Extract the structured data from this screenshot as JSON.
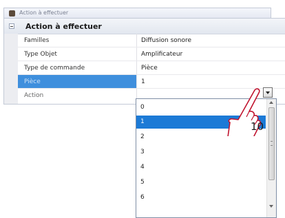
{
  "window": {
    "title": "Action à effectuer"
  },
  "category": {
    "label": "Action à effectuer"
  },
  "properties": [
    {
      "name": "Familles",
      "value": "Diffusion sonore"
    },
    {
      "name": "Type Objet",
      "value": "Amplificateur"
    },
    {
      "name": "Type de commande",
      "value": "Pièce"
    },
    {
      "name": "Pièce",
      "value": "1"
    },
    {
      "name": "Action",
      "value": ""
    }
  ],
  "dropdown": {
    "selected": "1",
    "options": [
      "0",
      "1",
      "2",
      "3",
      "4",
      "5",
      "6"
    ]
  },
  "callout": {
    "number": "10"
  },
  "icons": {
    "window": "app-icon",
    "collapse": "collapse-icon",
    "dropdown": "chevron-down-icon",
    "pointer": "hand-pointer-icon"
  },
  "colors": {
    "selection": "#1c7ad6",
    "grid_selection": "#3f8fdd"
  }
}
